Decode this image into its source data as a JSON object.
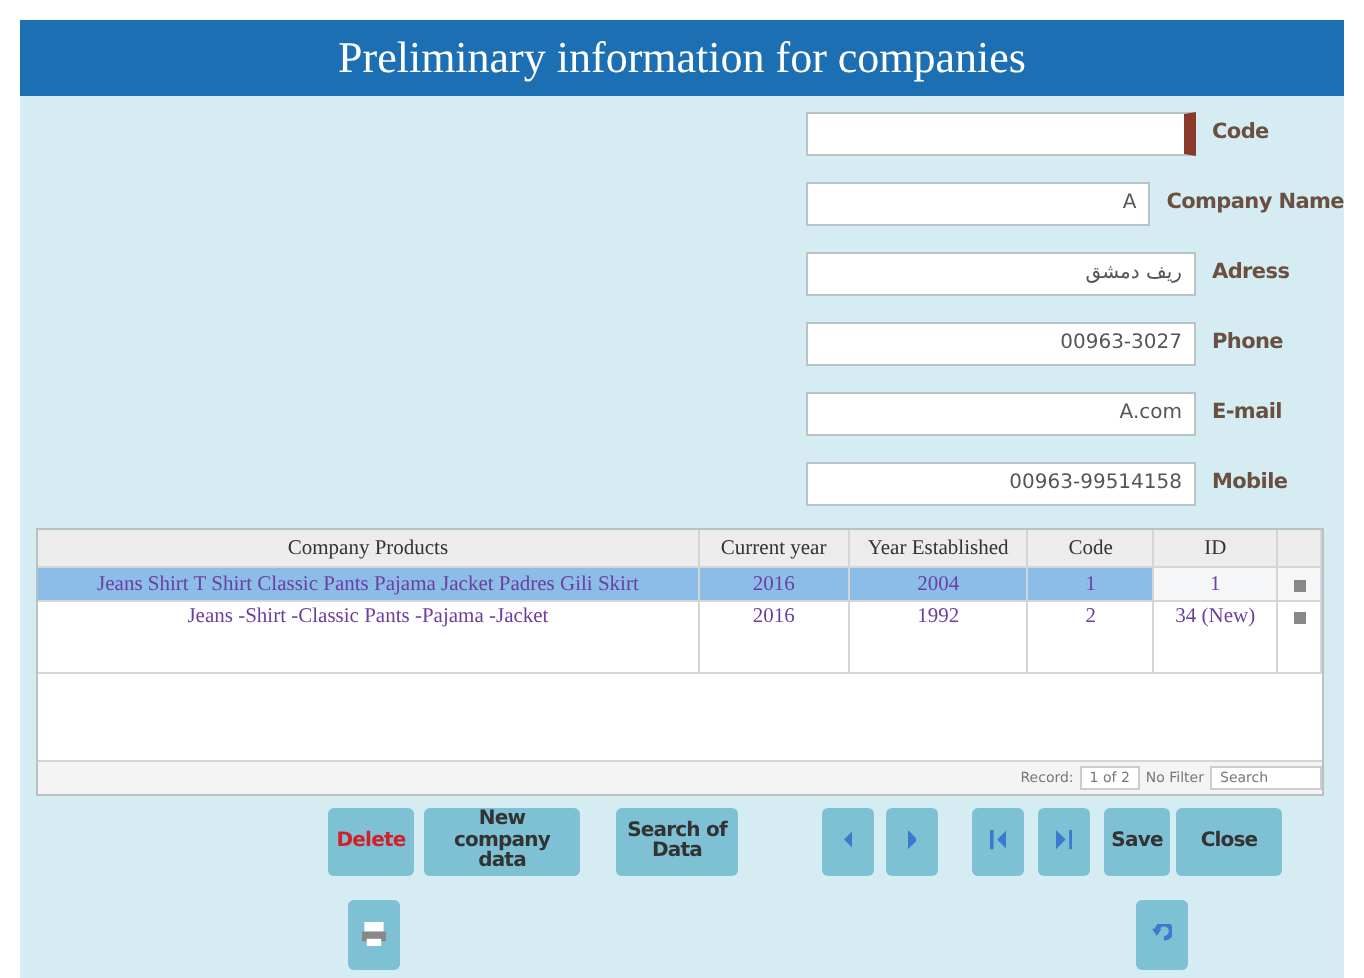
{
  "window": {
    "title": "Preliminary information for companies"
  },
  "fields": [
    {
      "label": "Code",
      "focused": true
    },
    {
      "label": "Company Name",
      "value": "A",
      "focused": false
    },
    {
      "label": "Adress",
      "value": "ريف دمشق",
      "focused": false
    },
    {
      "label": "Phone",
      "value": "00963-3027",
      "focused": false
    },
    {
      "label": "E-mail",
      "value": "A.com",
      "focused": false
    },
    {
      "label": "Mobile",
      "value": "00963-99514158",
      "focused": false
    }
  ],
  "table": {
    "columns": [
      "Company Products",
      "Current year",
      "Year Established",
      "Code",
      "ID"
    ],
    "rows": [
      {
        "cells": [
          "Jeans  Shirt  T Shirt  Classic Pants  Pajama  Jacket  Padres  Gili  Skirt",
          "2016",
          "2004",
          "1",
          "1"
        ],
        "selected": true
      },
      {
        "cells": [
          "Jeans -Shirt -Classic Pants -Pajama -Jacket",
          "2016",
          "1992",
          "2",
          "34 (New)"
        ],
        "selected": false
      }
    ],
    "navigation": {
      "label": "Record:",
      "position": "1 of 2",
      "filter": "No Filter",
      "search": "Search"
    }
  },
  "buttons": [
    {
      "kind": "danger",
      "label": "Delete"
    },
    {
      "kind": "text",
      "label": "New company data"
    },
    {
      "kind": "text",
      "label": "Search of Data"
    },
    {
      "kind": "prev"
    },
    {
      "kind": "next"
    },
    {
      "kind": "first"
    },
    {
      "kind": "last"
    },
    {
      "kind": "text",
      "label": "Save"
    },
    {
      "kind": "text",
      "label": "Close"
    }
  ],
  "lower_buttons": [
    {
      "kind": "print"
    },
    {
      "kind": "undo"
    }
  ]
}
